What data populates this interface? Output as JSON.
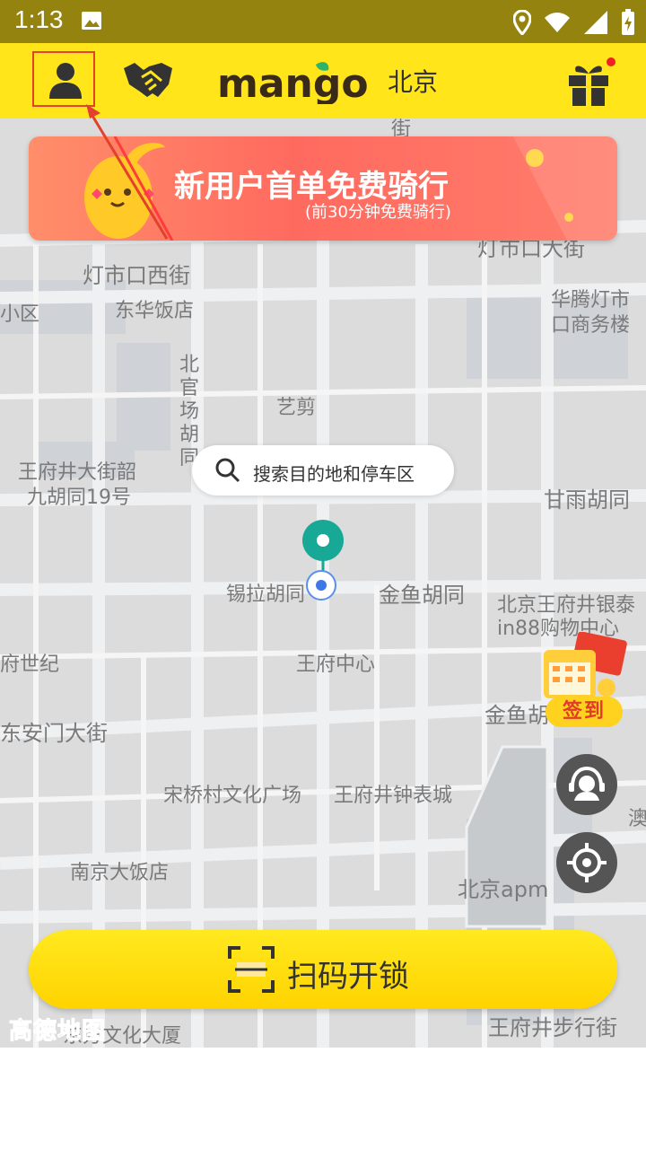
{
  "status_bar": {
    "time": "1:13"
  },
  "header": {
    "city": "北京",
    "logo_text": "mango"
  },
  "banner": {
    "title": "新用户首单免费骑行",
    "subtitle": "(前30分钟免费骑行)"
  },
  "search": {
    "placeholder": "搜索目的地和停车区"
  },
  "map_labels": [
    "街",
    "灯市口大街",
    "灯市口西街",
    "小区",
    "东华饭店",
    "华腾灯市",
    "口商务楼",
    "北官场胡同",
    "艺剪",
    "王府井大街韶",
    "九胡同19号",
    "甘雨胡同",
    "锡拉胡同",
    "金鱼胡同",
    "北京王府井银泰",
    "in88购物中心",
    "府世纪",
    "王府中心",
    "金鱼胡",
    "东安门大街",
    "宋桥村文化广场",
    "王府井钟表城",
    "澳",
    "南京大饭店",
    "北京apm",
    "东方文化大厦",
    "王府井步行街"
  ],
  "checkin": {
    "label": "签到"
  },
  "scan": {
    "label": "扫码开锁"
  },
  "map_attribution": "高德地图",
  "colors": {
    "status_bar": "#958310",
    "topbar": "#ffe51a",
    "accent": "#ffd300",
    "pin": "#17a896",
    "highlight_box": "#e2412c"
  }
}
